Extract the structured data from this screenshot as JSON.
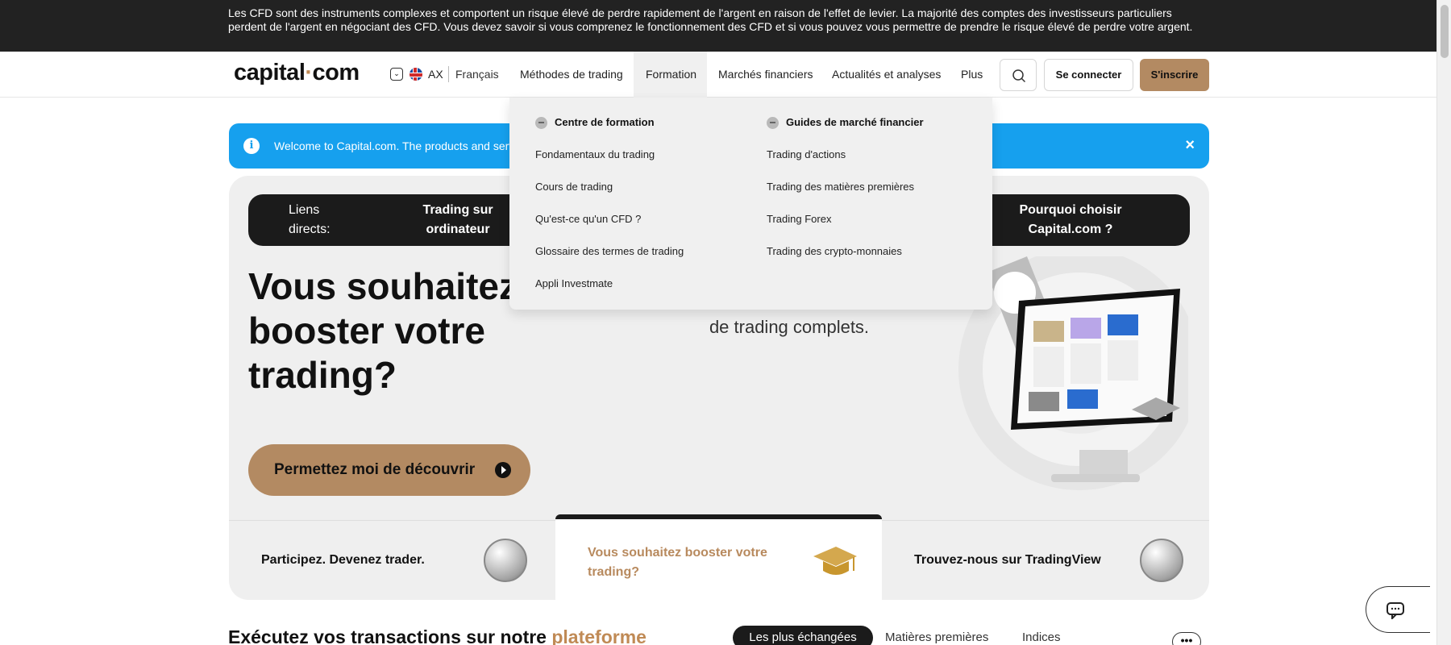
{
  "risk_banner": {
    "text": "Les CFD sont des instruments complexes et comportent un risque élevé de perdre rapidement de l'argent en raison de l'effet de levier. La majorité des comptes des investisseurs particuliers perdent de l'argent en négociant des CFD. Vous devez savoir si vous comprenez le fonctionnement des CFD et si vous pouvez vous permettre de prendre le risque élevé de perdre votre argent."
  },
  "header": {
    "logo_left": "capital",
    "logo_dot": "·",
    "logo_right": "com",
    "lang_toggle_icon": "chevron-down-icon",
    "region": "AX",
    "language": "Français",
    "nav": {
      "methods": "Méthodes de trading",
      "formation": "Formation",
      "markets": "Marchés financiers",
      "news": "Actualités et analyses",
      "more": "Plus"
    },
    "login": "Se connecter",
    "signup": "S'inscrire",
    "accent_color": "#b38a62"
  },
  "welcome": {
    "message": "Welcome to Capital.com. The products and servic",
    "close": "×"
  },
  "hero": {
    "quick_links_label": "Liens directs:",
    "quick_link_desktop": "Trading sur ordinateur",
    "quick_link_why": "Pourquoi choisir Capital.com ?",
    "title": "Vous souhaitez booster votre trading?",
    "subtitle_visible": "de trading complets.",
    "cta": "Permettez moi de découvrir",
    "tabs": [
      {
        "label": "Participez. Devenez trader."
      },
      {
        "label": "Vous souhaitez booster votre trading?"
      },
      {
        "label": "Trouvez-nous sur TradingView"
      }
    ]
  },
  "dropdown": {
    "col1_head": "Centre de formation",
    "col1_items": [
      "Fondamentaux du trading",
      "Cours de trading",
      "Qu'est-ce qu'un CFD ?",
      "Glossaire des termes de trading",
      "Appli Investmate"
    ],
    "col2_head": "Guides de marché financier",
    "col2_items": [
      "Trading d'actions",
      "Trading des matières premières",
      "Trading Forex",
      "Trading des crypto-monnaies"
    ]
  },
  "bottom": {
    "title_start": "Exécutez vos transactions sur notre ",
    "title_highlight": "plateforme",
    "pills": [
      "Les plus échangées",
      "Matières premières",
      "Indices"
    ],
    "more": "•••"
  }
}
